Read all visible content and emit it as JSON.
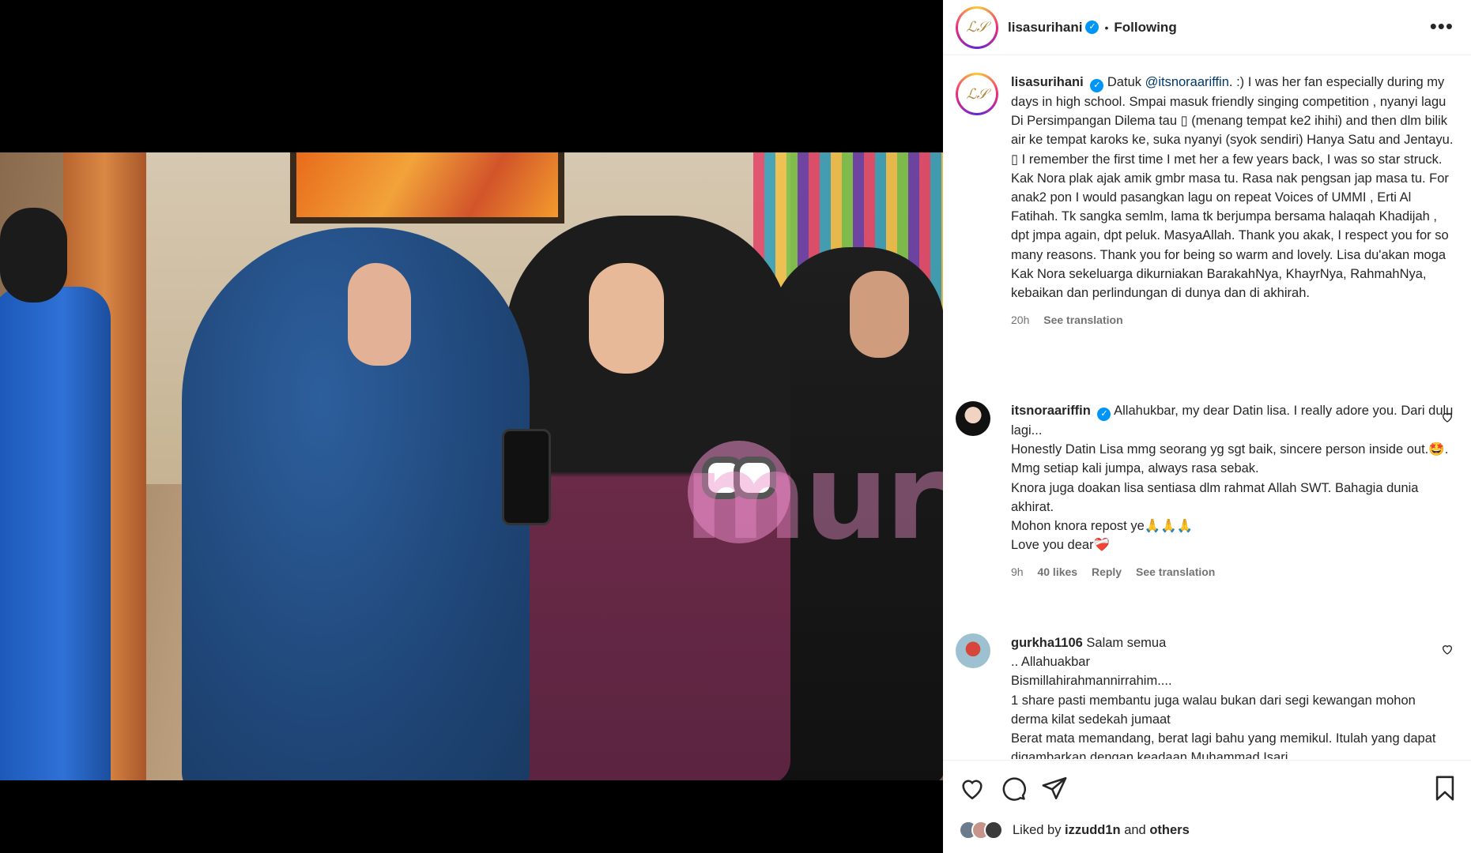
{
  "post": {
    "username": "lisasurihani",
    "follow_status": "Following",
    "avatar_text": "ℒ𝒮",
    "watermark_text": "mural",
    "caption": {
      "username": "lisasurihani",
      "prefix": "Datuk ",
      "mention": "@itsnoraariffin",
      "text": ". :) I was her fan especially during my days in high school. Smpai masuk friendly singing competition , nyanyi lagu Di Persimpangan Dilema tau ▯ (menang tempat ke2 ihihi) and then dlm bilik air ke tempat karoks ke, suka nyanyi (syok sendiri) Hanya Satu and Jentayu. ▯ I remember the first time I met her a few years back, I was so star struck. Kak Nora plak ajak amik gmbr masa tu. Rasa nak pengsan jap masa tu. For anak2 pon I would pasangkan lagu on repeat Voices of UMMI , Erti Al Fatihah. Tk sangka semlm, lama tk berjumpa bersama halaqah Khadijah , dpt jmpa again, dpt peluk. MasyaAllah. Thank you akak, I respect you for so many reasons. Thank you for being so warm and lovely. Lisa du'akan moga Kak Nora sekeluarga dikurniakan BarakahNya, KhayrNya, RahmahNya, kebaikan dan perlindungan di dunya dan di akhirah.",
      "time": "20h",
      "see_translation": "See translation"
    },
    "comments": [
      {
        "username": "itsnoraariffin",
        "lines": [
          "Allahukbar, my dear Datin lisa. I really adore you. Dari dulu lagi...",
          "Honestly Datin Lisa mmg seorang yg sgt baik, sincere person inside out.🤩.",
          "Mmg setiap kali jumpa, always rasa sebak.",
          "Knora juga doakan lisa sentiasa dlm rahmat Allah SWT. Bahagia dunia akhirat.",
          "Mohon knora repost ye🙏🙏🙏",
          "Love you dear❤️‍🩹"
        ],
        "time": "9h",
        "likes": "40 likes",
        "reply": "Reply",
        "see_translation": "See translation"
      },
      {
        "username": "gurkha1106",
        "lines": [
          "Salam semua",
          ".. Allahuakbar",
          "Bismillahirahmannirrahim....",
          "1 share pasti membantu juga walau bukan dari segi kewangan mohon derma kilat sedekah jumaat",
          "Berat mata memandang, berat lagi bahu yang memikul. Itulah yang dapat digambarkan dengan keadaan Muhammad Isari"
        ]
      }
    ],
    "liked_by": {
      "prefix": "Liked by ",
      "user": "izzudd1n",
      "middle": " and ",
      "others": "others"
    }
  },
  "icons": [
    "heart-icon",
    "comment-icon",
    "share-icon",
    "bookmark-icon",
    "more-icon",
    "verified-icon"
  ]
}
